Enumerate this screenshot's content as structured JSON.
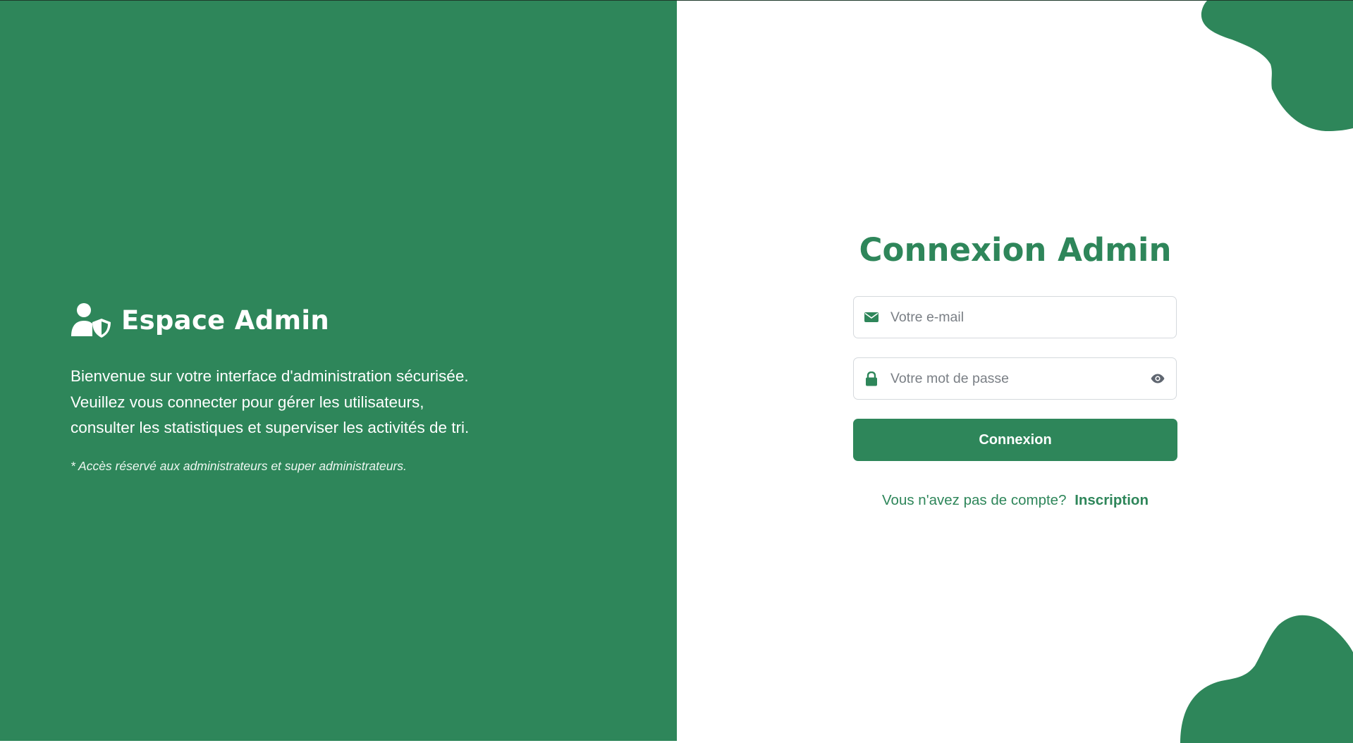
{
  "colors": {
    "brand_green": "#2e865a",
    "white": "#ffffff",
    "input_border": "#d5d9dd",
    "placeholder": "#7a7f85",
    "eye_icon": "#5f6670"
  },
  "left_panel": {
    "brand_icon": "user-shield-icon",
    "title": "Espace Admin",
    "welcome_lines": [
      "Bienvenue sur votre interface d'administration sécurisée.",
      "Veuillez vous connecter pour gérer les utilisateurs,",
      "consulter les statistiques et superviser les activités de tri."
    ],
    "notice": "* Accès réservé aux administrateurs et super administrateurs."
  },
  "login_form": {
    "title": "Connexion Admin",
    "email": {
      "icon": "envelope-icon",
      "placeholder": "Votre e-mail",
      "value": ""
    },
    "password": {
      "icon": "lock-icon",
      "placeholder": "Votre mot de passe",
      "value": "",
      "toggle_icon": "eye-icon"
    },
    "submit_label": "Connexion",
    "signup_prompt": "Vous n'avez pas de compte?",
    "signup_link": "Inscription"
  }
}
